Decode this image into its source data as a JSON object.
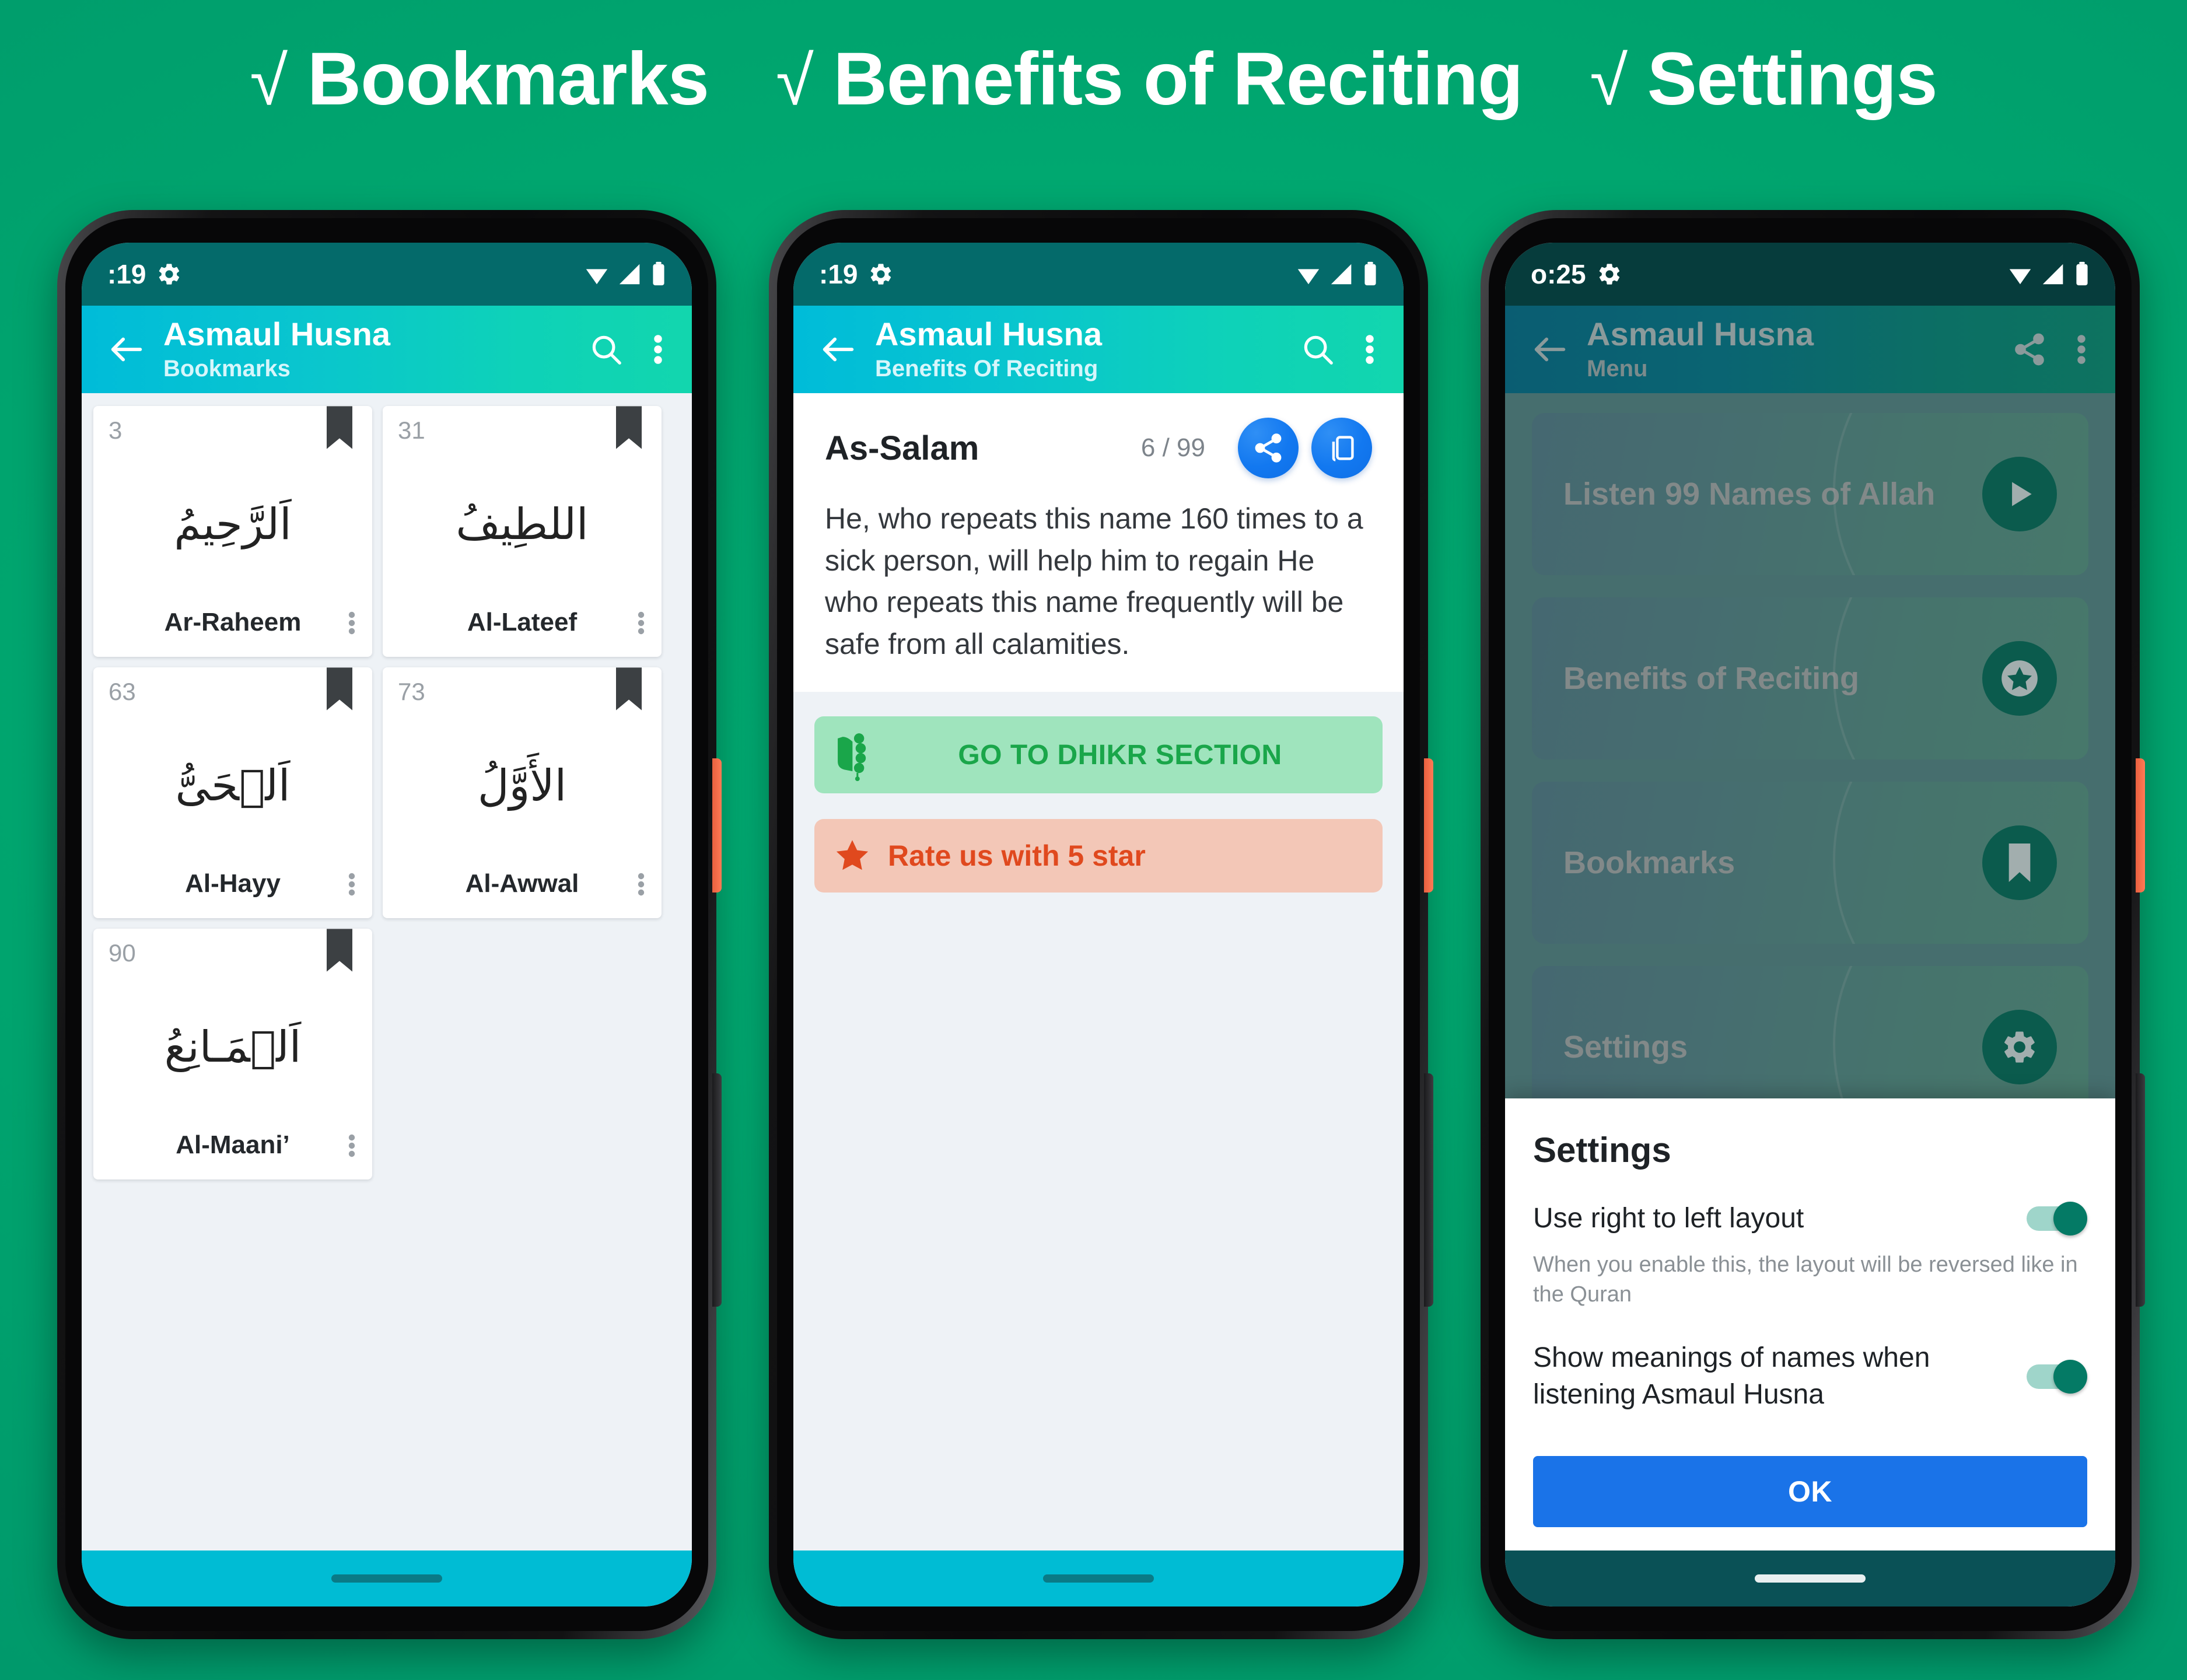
{
  "headline": {
    "check": "√",
    "item1": "Bookmarks",
    "item2": "Benefits of Reciting",
    "item3": "Settings"
  },
  "colors": {
    "background_green": "#00a46e",
    "appbar_cyan": "#00bcd9",
    "appbar_teal": "#12d6ae",
    "statusbar": "#046a6a",
    "accent_blue": "#1a73e8",
    "dhikr_green_bg": "#9fe4bd",
    "dhikr_green_text": "#1aa64a",
    "rate_bg": "#f3c7b7",
    "rate_text": "#e0491e",
    "toggle_on": "#047a65",
    "menu_card_gradient_start": "#0c5d73",
    "menu_card_gradient_end": "#0f8564",
    "power_button": "#e8603f"
  },
  "phone1": {
    "statusbar": {
      "time": ":19",
      "gear_icon": "gear-icon",
      "wifi_icon": "wifi-icon",
      "signal_icon": "signal-icon",
      "battery_icon": "battery-icon"
    },
    "appbar": {
      "back_icon": "back-arrow-icon",
      "title": "Asmaul Husna",
      "subtitle": "Bookmarks",
      "search_icon": "search-icon",
      "overflow_icon": "overflow-menu-icon"
    },
    "cards": [
      {
        "number": "3",
        "arabic": "اَلرَّحِيمُ",
        "name": "Ar-Raheem",
        "bookmark_icon": "bookmark-icon",
        "menu_icon": "overflow-menu-icon"
      },
      {
        "number": "31",
        "arabic": "اللطِيفُ",
        "name": "Al-Lateef",
        "bookmark_icon": "bookmark-icon",
        "menu_icon": "overflow-menu-icon"
      },
      {
        "number": "63",
        "arabic": "اَلۡحَىُّ",
        "name": "Al-Hayy",
        "bookmark_icon": "bookmark-icon",
        "menu_icon": "overflow-menu-icon"
      },
      {
        "number": "73",
        "arabic": "الأَوَّلُ",
        "name": "Al-Awwal",
        "bookmark_icon": "bookmark-icon",
        "menu_icon": "overflow-menu-icon"
      },
      {
        "number": "90",
        "arabic": "اَلۡمَـانِعُ",
        "name": "Al-Maani’",
        "bookmark_icon": "bookmark-icon",
        "menu_icon": "overflow-menu-icon"
      }
    ]
  },
  "phone2": {
    "statusbar": {
      "time": ":19",
      "gear_icon": "gear-icon"
    },
    "appbar": {
      "back_icon": "back-arrow-icon",
      "title": "Asmaul Husna",
      "subtitle": "Benefits Of Reciting",
      "search_icon": "search-icon",
      "overflow_icon": "overflow-menu-icon"
    },
    "benefit": {
      "name": "As-Salam",
      "counter": "6 / 99",
      "share_icon": "share-icon",
      "copy_icon": "copy-icon",
      "text": "He, who repeats this name 160 times to a sick person, will help him to regain  He who repeats this name frequently will be safe from all calamities."
    },
    "dhikr_button": {
      "label": "GO TO DHIKR SECTION",
      "icon": "tasbih-beads-icon"
    },
    "rate_button": {
      "label": "Rate us with 5 star",
      "icon": "star-icon"
    }
  },
  "phone3": {
    "statusbar": {
      "time": "o:25",
      "gear_icon": "gear-icon"
    },
    "appbar": {
      "back_icon": "back-arrow-icon",
      "title": "Asmaul Husna",
      "subtitle": "Menu",
      "share_icon": "share-icon",
      "overflow_icon": "overflow-menu-icon"
    },
    "menu_items": [
      {
        "label": "Listen 99 Names of Allah",
        "icon": "play-icon"
      },
      {
        "label": "Benefits of Reciting",
        "icon": "star-circle-icon"
      },
      {
        "label": "Bookmarks",
        "icon": "bookmark-icon"
      },
      {
        "label": "Settings",
        "icon": "gear-icon"
      }
    ],
    "dialog": {
      "title": "Settings",
      "row1": {
        "label": "Use right to left layout",
        "toggle_state": "on",
        "help": "When you enable this, the layout will be reversed like in the Quran"
      },
      "row2": {
        "label": "Show meanings of names when listening Asmaul Husna",
        "toggle_state": "on"
      },
      "ok_label": "OK"
    }
  }
}
